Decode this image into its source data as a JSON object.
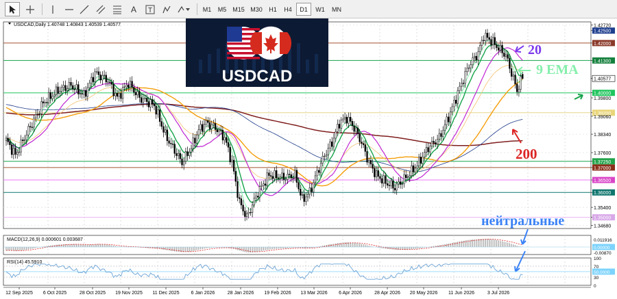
{
  "toolbar": {
    "tools": [
      {
        "icon": "cursor-arrow-icon"
      },
      {
        "icon": "crosshair-icon"
      },
      {
        "icon": "horizontal-line-icon"
      },
      {
        "icon": "trend-line-icon"
      },
      {
        "icon": "channel-icon"
      },
      {
        "icon": "fibonacci-icon"
      },
      {
        "icon": "text-icon"
      },
      {
        "icon": "text-label-icon"
      },
      {
        "icon": "shapes-dropdown-icon"
      }
    ],
    "timeframes": [
      "M1",
      "M5",
      "M15",
      "M30",
      "H1",
      "H4",
      "D1",
      "W1",
      "MN"
    ],
    "active_timeframe": "D1"
  },
  "main_chart": {
    "header": "USDCAD,Daily  1.40748 1.40843 1.40539 1.40577",
    "logo_text": "USDCAD",
    "price_labels": [
      {
        "text": "1.42720",
        "value": 1.4272,
        "highlight": false
      },
      {
        "text": "1.42500",
        "value": 1.425,
        "highlight": true,
        "bg": "#1f3f8f",
        "fg": "#ffffff"
      },
      {
        "text": "1.42000",
        "value": 1.42,
        "highlight": true,
        "bg": "#8b3a2a",
        "fg": "#ffffff"
      },
      {
        "text": "1.41300",
        "value": 1.413,
        "highlight": true,
        "bg": "#15803d",
        "fg": "#ffffff"
      },
      {
        "text": "1.40577",
        "value": 1.40577,
        "highlight": true,
        "bg": "#ffffff",
        "fg": "#000000",
        "bordered": true
      },
      {
        "text": "1.40000",
        "value": 1.4,
        "highlight": true,
        "bg": "#22c55e",
        "fg": "#ffffff"
      },
      {
        "text": "1.39800",
        "value": 1.398,
        "highlight": false
      },
      {
        "text": "1.39200",
        "value": 1.392,
        "highlight": true,
        "bg": "#e9d67a",
        "fg": "#ffffff"
      },
      {
        "text": "1.39060",
        "value": 1.3906,
        "highlight": false
      },
      {
        "text": "1.38340",
        "value": 1.3834,
        "highlight": false
      },
      {
        "text": "1.37600",
        "value": 1.376,
        "highlight": false
      },
      {
        "text": "1.37250",
        "value": 1.3725,
        "highlight": true,
        "bg": "#22a34a",
        "fg": "#ffffff"
      },
      {
        "text": "1.37000",
        "value": 1.37,
        "highlight": true,
        "bg": "#8b2e1a",
        "fg": "#ffffff"
      },
      {
        "text": "1.36500",
        "value": 1.365,
        "highlight": true,
        "bg": "#d946c8",
        "fg": "#ffffff"
      },
      {
        "text": "1.36000",
        "value": 1.36,
        "highlight": true,
        "bg": "#0f766e",
        "fg": "#ffffff"
      },
      {
        "text": "1.35400",
        "value": 1.354,
        "highlight": false
      },
      {
        "text": "1.35000",
        "value": 1.35,
        "highlight": true,
        "bg": "#d8a8e8",
        "fg": "#ffffff"
      },
      {
        "text": "1.34680",
        "value": 1.3468,
        "highlight": false
      }
    ],
    "hlines": [
      {
        "value": 1.42,
        "color": "#a0522d"
      },
      {
        "value": 1.413,
        "color": "#16a34a"
      },
      {
        "value": 1.4,
        "color": "#22c55e"
      },
      {
        "value": 1.392,
        "color": "#e7d58a"
      },
      {
        "value": 1.3725,
        "color": "#16a34a"
      },
      {
        "value": 1.37,
        "color": "#a0522d"
      },
      {
        "value": 1.365,
        "color": "#e879f9"
      },
      {
        "value": 1.36,
        "color": "#0f766e"
      },
      {
        "value": 1.35,
        "color": "#e9b5f5"
      }
    ],
    "date_labels": [
      "12 Sep 2025",
      "6 Oct 2025",
      "28 Oct 2025",
      "19 Nov 2025",
      "11 Dec 2025",
      "6 Jan 2026",
      "28 Jan 2026",
      "19 Feb 2026",
      "13 Mar 2026",
      "6 Apr 2026",
      "28 Apr 2026",
      "20 May 2026",
      "11 Jun 2026",
      "3 Jul 2026"
    ]
  },
  "annotations": [
    {
      "text": "20",
      "color": "#7c3aed"
    },
    {
      "text": "9 EMA",
      "color": "#86efac"
    },
    {
      "text": "200",
      "color": "#dc2626"
    },
    {
      "text": "нейтральные",
      "color": "#3b82f6"
    }
  ],
  "macd_panel": {
    "header": "MACD(12,26,9) 0.000601 0.003687",
    "scale_labels": [
      "0.011916",
      "0.00000",
      "-0.00870"
    ]
  },
  "rsi_panel": {
    "header": "RSI(14) 45.5910",
    "scale_labels": [
      "100",
      "70",
      "50.0000",
      "30",
      "0"
    ]
  },
  "colors": {
    "ema9": "#16a34a",
    "ma20": "#c026d3",
    "ma50": "#f59e0b",
    "ma200": "#7f1d1d",
    "rsi": "#6ba3d6",
    "macd_bar": "#a8a8a8",
    "macd_signal": "#dc2626"
  }
}
